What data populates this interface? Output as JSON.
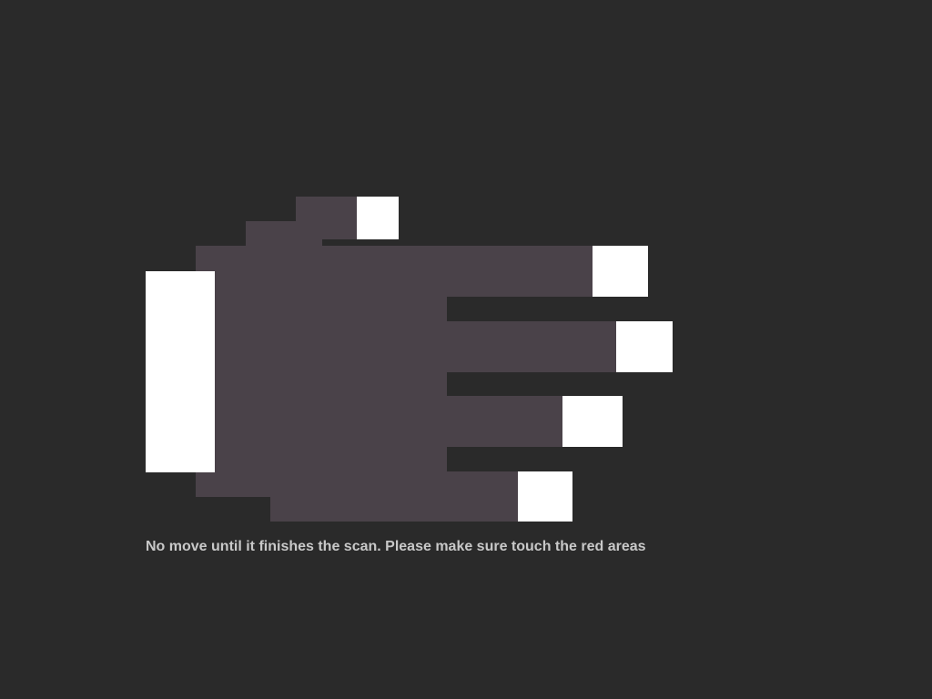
{
  "scan": {
    "instruction": "No move until it finishes the scan. Please make sure touch the red areas",
    "touch_areas": [
      {
        "name": "thumb-touch-area"
      },
      {
        "name": "index-finger-touch-area"
      },
      {
        "name": "middle-finger-touch-area"
      },
      {
        "name": "ring-finger-touch-area"
      },
      {
        "name": "little-finger-touch-area"
      },
      {
        "name": "palm-heel-touch-area"
      }
    ]
  },
  "colors": {
    "background": "#2a2a2a",
    "hand": "#4a4249",
    "touch_area": "#ffffff",
    "text": "#c8c8c8"
  }
}
